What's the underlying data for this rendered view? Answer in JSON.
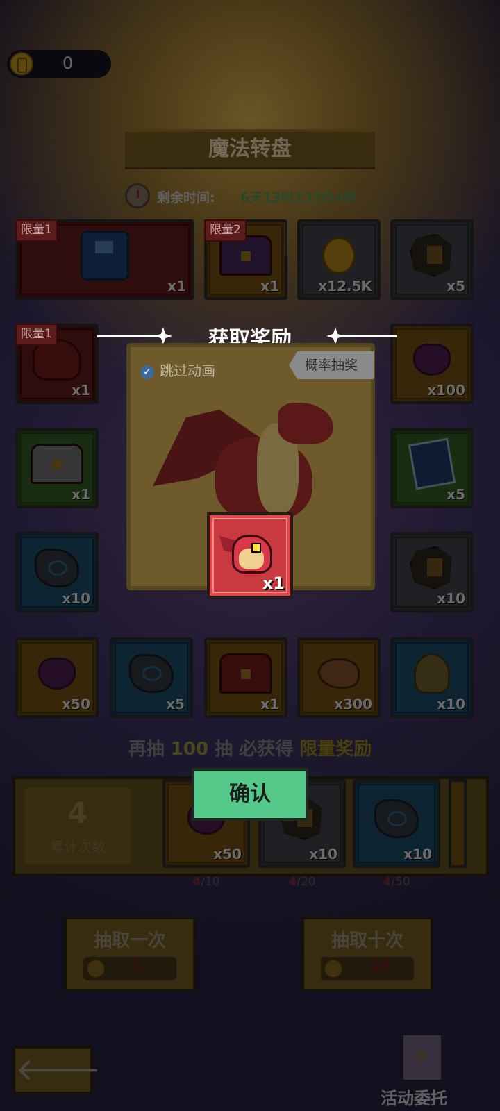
{
  "currency": {
    "value": "0",
    "icon": "coin-icon"
  },
  "title": "魔法转盘",
  "timer": {
    "label": "剩余时间:",
    "value": "6天13时23分54秒"
  },
  "grid": {
    "row1": [
      {
        "badge": "限量1",
        "qty": "x1",
        "icon": "robot-hero-icon",
        "color": "red"
      },
      {
        "badge": "限量2",
        "qty": "x1",
        "icon": "purple-chest-icon",
        "color": "orange"
      },
      {
        "qty": "x12.5K",
        "icon": "gold-coin-icon",
        "color": "gray"
      },
      {
        "qty": "x5",
        "icon": "ore-rock-icon",
        "color": "gray"
      }
    ],
    "left_col": [
      {
        "badge": "限量1",
        "qty": "x1",
        "icon": "red-dragon-icon",
        "color": "red"
      },
      {
        "qty": "x1",
        "icon": "white-chest-icon",
        "color": "green"
      },
      {
        "qty": "x10",
        "icon": "blue-stone-icon",
        "color": "blue"
      }
    ],
    "right_col": [
      {
        "qty": "x100",
        "icon": "purple-gem-icon",
        "color": "orange"
      },
      {
        "qty": "x5",
        "icon": "card-pack-icon",
        "color": "green"
      },
      {
        "qty": "x10",
        "icon": "ore-rock-icon",
        "color": "gray"
      }
    ],
    "bottom_row": [
      {
        "qty": "x50",
        "icon": "purple-gem-icon",
        "color": "orange"
      },
      {
        "qty": "x5",
        "icon": "blue-stone-icon",
        "color": "blue"
      },
      {
        "qty": "x1",
        "icon": "red-chest-icon",
        "color": "orange"
      },
      {
        "qty": "x300",
        "icon": "meat-icon",
        "color": "orange"
      },
      {
        "qty": "x10",
        "icon": "octopus-icon",
        "color": "blue"
      }
    ]
  },
  "popup": {
    "title": "获取奖励",
    "skip_label": "跳过动画",
    "prob_label": "概率抽奖",
    "reward_qty": "x1",
    "reward_icon": "red-dragon-icon",
    "confirm_label": "确认"
  },
  "guarantee": {
    "prefix": "再抽",
    "count": "100",
    "mid": "抽 必获得",
    "highlight": "限量奖励"
  },
  "progress": {
    "count": "4",
    "count_label": "累计次数",
    "milestones": [
      {
        "qty": "x50",
        "icon": "purple-gem-icon",
        "current": "4",
        "total": "/10"
      },
      {
        "qty": "x10",
        "icon": "ore-rock-icon",
        "current": "4",
        "total": "/20"
      },
      {
        "qty": "x10",
        "icon": "blue-stone-icon",
        "current": "4",
        "total": "/50"
      }
    ]
  },
  "draw_once": {
    "label": "抽取一次",
    "cost": "1"
  },
  "draw_ten": {
    "label": "抽取十次",
    "cost": "10"
  },
  "quest": {
    "label": "活动委托"
  },
  "back_arrow": "🡐",
  "colors": {
    "confirm": "#54c98a",
    "reward_card": "#e5464a",
    "timer_value": "#4c8a52"
  }
}
